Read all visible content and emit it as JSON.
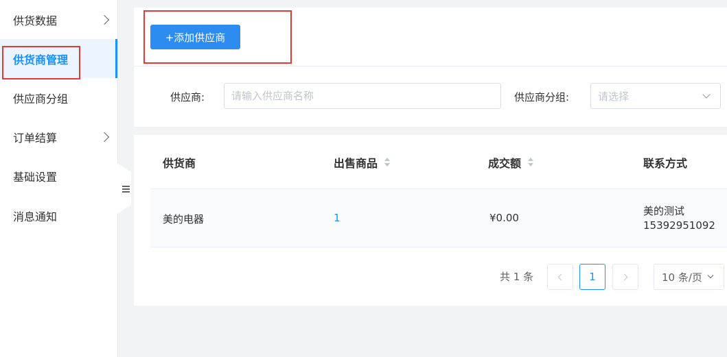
{
  "sidebar": {
    "items": [
      {
        "label": "供货数据",
        "has_arrow": true
      },
      {
        "label": "供货商管理",
        "active": true
      },
      {
        "label": "供应商分组"
      },
      {
        "label": "订单结算",
        "has_arrow": true
      },
      {
        "label": "基础设置"
      },
      {
        "label": "消息通知"
      }
    ]
  },
  "toolbar": {
    "add_label": "+添加供应商"
  },
  "filters": {
    "supplier_label": "供应商:",
    "supplier_placeholder": "请输入供应商名称",
    "supplier_value": "",
    "group_label": "供应商分组:",
    "group_placeholder": "请选择"
  },
  "table": {
    "columns": [
      "供货商",
      "出售商品",
      "成交额",
      "联系方式"
    ],
    "sortable": [
      false,
      true,
      true,
      false
    ],
    "rows": [
      {
        "supplier": "美的电器",
        "products": "1",
        "amount": "¥0.00",
        "contact_name": "美的测试",
        "contact_phone": "15392951092"
      }
    ]
  },
  "pagination": {
    "total_text": "共 1 条",
    "current_page": "1",
    "page_size": "10 条/页"
  },
  "colors": {
    "primary": "#2d8cf0",
    "active_text": "#1890ff",
    "highlight_box": "#e53935"
  }
}
